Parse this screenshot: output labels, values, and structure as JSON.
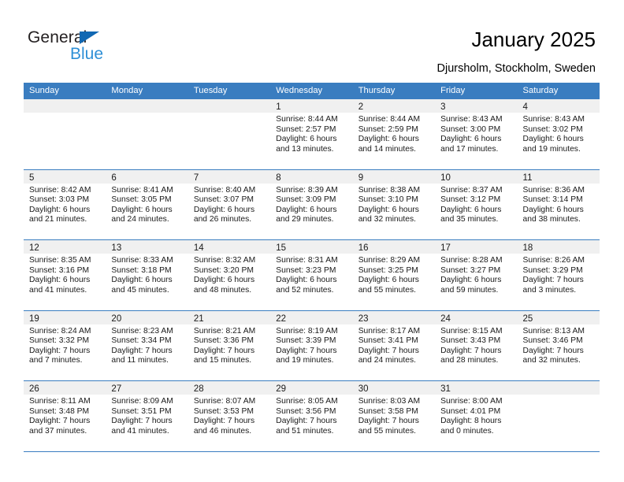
{
  "brand": {
    "word_one": "General",
    "word_two": "Blue",
    "accent_color": "#2e8fd6",
    "triangle_color": "#1168b3"
  },
  "header": {
    "title": "January 2025",
    "subtitle": "Djursholm, Stockholm, Sweden"
  },
  "calendar": {
    "header_color": "#3a7dc0",
    "weekdays": [
      "Sunday",
      "Monday",
      "Tuesday",
      "Wednesday",
      "Thursday",
      "Friday",
      "Saturday"
    ],
    "weeks": [
      [
        {
          "day": "",
          "lines": []
        },
        {
          "day": "",
          "lines": []
        },
        {
          "day": "",
          "lines": []
        },
        {
          "day": "1",
          "lines": [
            "Sunrise: 8:44 AM",
            "Sunset: 2:57 PM",
            "Daylight: 6 hours",
            "and 13 minutes."
          ]
        },
        {
          "day": "2",
          "lines": [
            "Sunrise: 8:44 AM",
            "Sunset: 2:59 PM",
            "Daylight: 6 hours",
            "and 14 minutes."
          ]
        },
        {
          "day": "3",
          "lines": [
            "Sunrise: 8:43 AM",
            "Sunset: 3:00 PM",
            "Daylight: 6 hours",
            "and 17 minutes."
          ]
        },
        {
          "day": "4",
          "lines": [
            "Sunrise: 8:43 AM",
            "Sunset: 3:02 PM",
            "Daylight: 6 hours",
            "and 19 minutes."
          ]
        }
      ],
      [
        {
          "day": "5",
          "lines": [
            "Sunrise: 8:42 AM",
            "Sunset: 3:03 PM",
            "Daylight: 6 hours",
            "and 21 minutes."
          ]
        },
        {
          "day": "6",
          "lines": [
            "Sunrise: 8:41 AM",
            "Sunset: 3:05 PM",
            "Daylight: 6 hours",
            "and 24 minutes."
          ]
        },
        {
          "day": "7",
          "lines": [
            "Sunrise: 8:40 AM",
            "Sunset: 3:07 PM",
            "Daylight: 6 hours",
            "and 26 minutes."
          ]
        },
        {
          "day": "8",
          "lines": [
            "Sunrise: 8:39 AM",
            "Sunset: 3:09 PM",
            "Daylight: 6 hours",
            "and 29 minutes."
          ]
        },
        {
          "day": "9",
          "lines": [
            "Sunrise: 8:38 AM",
            "Sunset: 3:10 PM",
            "Daylight: 6 hours",
            "and 32 minutes."
          ]
        },
        {
          "day": "10",
          "lines": [
            "Sunrise: 8:37 AM",
            "Sunset: 3:12 PM",
            "Daylight: 6 hours",
            "and 35 minutes."
          ]
        },
        {
          "day": "11",
          "lines": [
            "Sunrise: 8:36 AM",
            "Sunset: 3:14 PM",
            "Daylight: 6 hours",
            "and 38 minutes."
          ]
        }
      ],
      [
        {
          "day": "12",
          "lines": [
            "Sunrise: 8:35 AM",
            "Sunset: 3:16 PM",
            "Daylight: 6 hours",
            "and 41 minutes."
          ]
        },
        {
          "day": "13",
          "lines": [
            "Sunrise: 8:33 AM",
            "Sunset: 3:18 PM",
            "Daylight: 6 hours",
            "and 45 minutes."
          ]
        },
        {
          "day": "14",
          "lines": [
            "Sunrise: 8:32 AM",
            "Sunset: 3:20 PM",
            "Daylight: 6 hours",
            "and 48 minutes."
          ]
        },
        {
          "day": "15",
          "lines": [
            "Sunrise: 8:31 AM",
            "Sunset: 3:23 PM",
            "Daylight: 6 hours",
            "and 52 minutes."
          ]
        },
        {
          "day": "16",
          "lines": [
            "Sunrise: 8:29 AM",
            "Sunset: 3:25 PM",
            "Daylight: 6 hours",
            "and 55 minutes."
          ]
        },
        {
          "day": "17",
          "lines": [
            "Sunrise: 8:28 AM",
            "Sunset: 3:27 PM",
            "Daylight: 6 hours",
            "and 59 minutes."
          ]
        },
        {
          "day": "18",
          "lines": [
            "Sunrise: 8:26 AM",
            "Sunset: 3:29 PM",
            "Daylight: 7 hours",
            "and 3 minutes."
          ]
        }
      ],
      [
        {
          "day": "19",
          "lines": [
            "Sunrise: 8:24 AM",
            "Sunset: 3:32 PM",
            "Daylight: 7 hours",
            "and 7 minutes."
          ]
        },
        {
          "day": "20",
          "lines": [
            "Sunrise: 8:23 AM",
            "Sunset: 3:34 PM",
            "Daylight: 7 hours",
            "and 11 minutes."
          ]
        },
        {
          "day": "21",
          "lines": [
            "Sunrise: 8:21 AM",
            "Sunset: 3:36 PM",
            "Daylight: 7 hours",
            "and 15 minutes."
          ]
        },
        {
          "day": "22",
          "lines": [
            "Sunrise: 8:19 AM",
            "Sunset: 3:39 PM",
            "Daylight: 7 hours",
            "and 19 minutes."
          ]
        },
        {
          "day": "23",
          "lines": [
            "Sunrise: 8:17 AM",
            "Sunset: 3:41 PM",
            "Daylight: 7 hours",
            "and 24 minutes."
          ]
        },
        {
          "day": "24",
          "lines": [
            "Sunrise: 8:15 AM",
            "Sunset: 3:43 PM",
            "Daylight: 7 hours",
            "and 28 minutes."
          ]
        },
        {
          "day": "25",
          "lines": [
            "Sunrise: 8:13 AM",
            "Sunset: 3:46 PM",
            "Daylight: 7 hours",
            "and 32 minutes."
          ]
        }
      ],
      [
        {
          "day": "26",
          "lines": [
            "Sunrise: 8:11 AM",
            "Sunset: 3:48 PM",
            "Daylight: 7 hours",
            "and 37 minutes."
          ]
        },
        {
          "day": "27",
          "lines": [
            "Sunrise: 8:09 AM",
            "Sunset: 3:51 PM",
            "Daylight: 7 hours",
            "and 41 minutes."
          ]
        },
        {
          "day": "28",
          "lines": [
            "Sunrise: 8:07 AM",
            "Sunset: 3:53 PM",
            "Daylight: 7 hours",
            "and 46 minutes."
          ]
        },
        {
          "day": "29",
          "lines": [
            "Sunrise: 8:05 AM",
            "Sunset: 3:56 PM",
            "Daylight: 7 hours",
            "and 51 minutes."
          ]
        },
        {
          "day": "30",
          "lines": [
            "Sunrise: 8:03 AM",
            "Sunset: 3:58 PM",
            "Daylight: 7 hours",
            "and 55 minutes."
          ]
        },
        {
          "day": "31",
          "lines": [
            "Sunrise: 8:00 AM",
            "Sunset: 4:01 PM",
            "Daylight: 8 hours",
            "and 0 minutes."
          ]
        },
        {
          "day": "",
          "lines": []
        }
      ]
    ]
  }
}
